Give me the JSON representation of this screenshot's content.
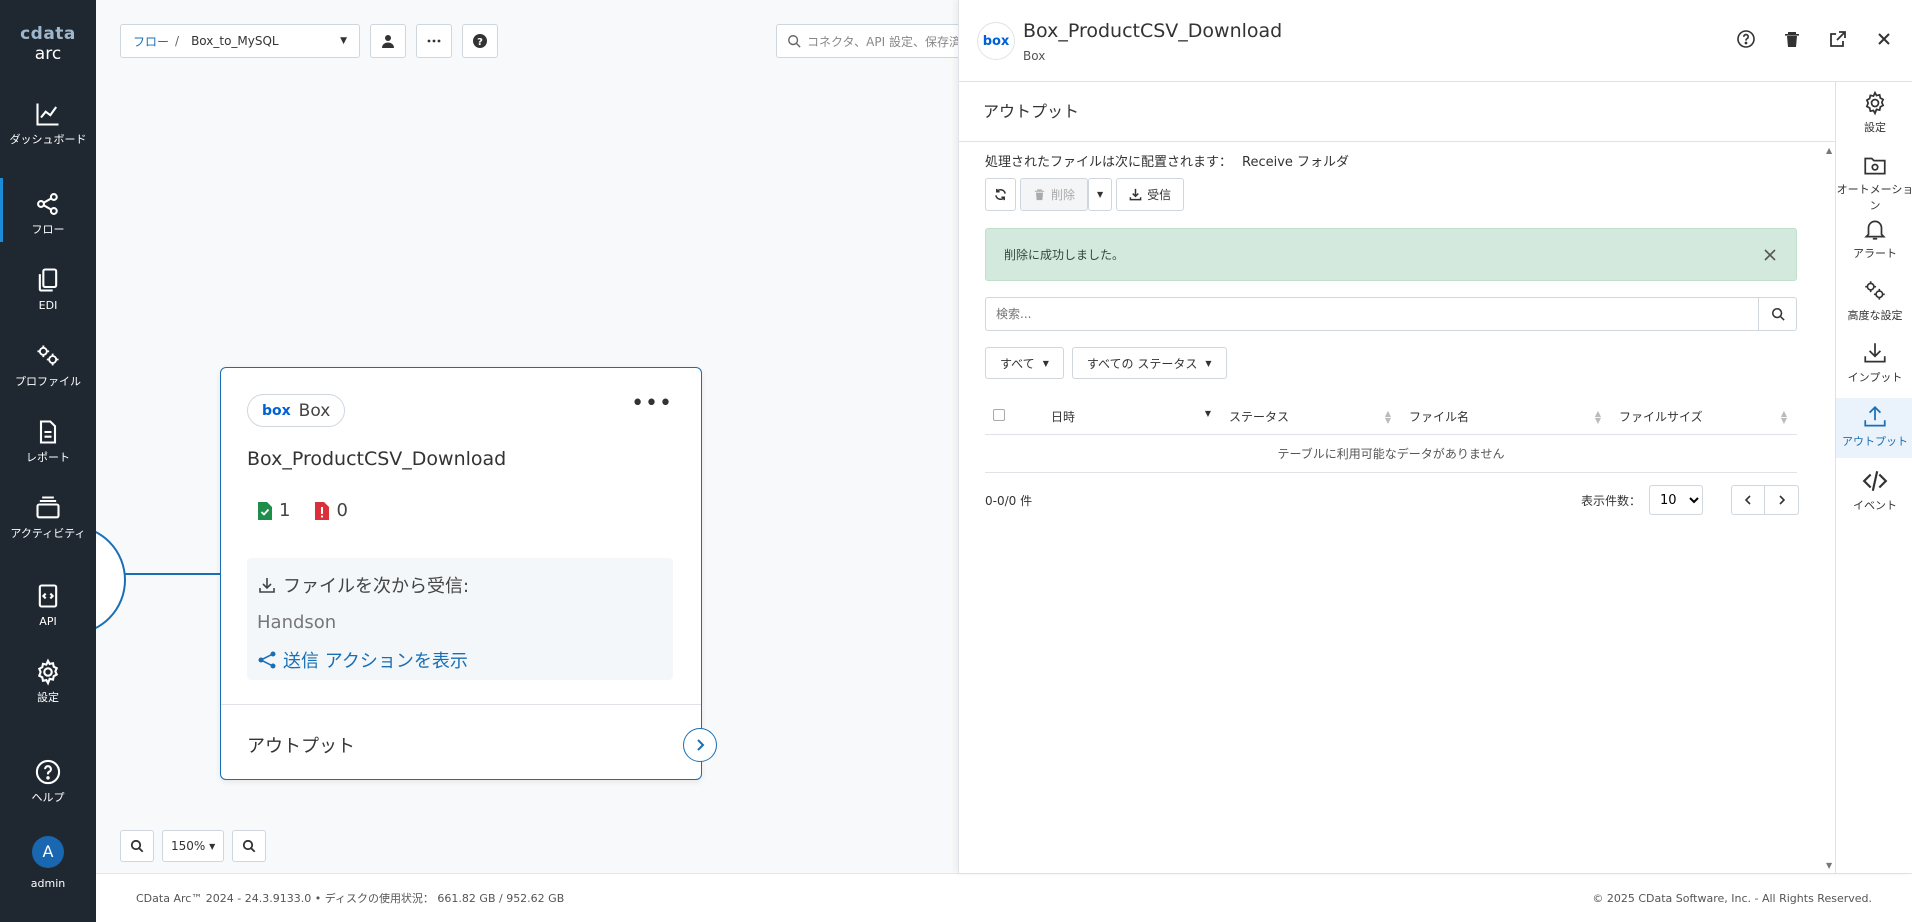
{
  "brand": {
    "line1": "cdata",
    "line2": "arc"
  },
  "nav": {
    "items": [
      {
        "label": "ダッシュボード"
      },
      {
        "label": "フロー"
      },
      {
        "label": "EDI"
      },
      {
        "label": "プロファイル"
      },
      {
        "label": "レポート"
      },
      {
        "label": "アクティビティ"
      },
      {
        "label": "API"
      },
      {
        "label": "設定"
      },
      {
        "label": "ヘルプ"
      }
    ],
    "user": {
      "initial": "A",
      "name": "admin"
    }
  },
  "breadcrumb": {
    "root": "フロー",
    "separator": "/",
    "current": "Box_to_MySQL"
  },
  "top_search": {
    "placeholder": "コネクタ、API 設定、保存済み"
  },
  "node": {
    "connector_label": "Box",
    "connector_logo": "box",
    "title": "Box_ProductCSV_Download",
    "success_count": "1",
    "error_count": "0",
    "receive_label": "ファイルを次から受信:",
    "receive_folder": "Handson",
    "send_action": "送信 アクションを表示",
    "output_label": "アウトプット"
  },
  "zoom": {
    "level": "150%"
  },
  "footer": {
    "version": "CData Arc™ 2024 - 24.3.9133.0 • ディスクの使用状況： 661.82 GB / 952.62 GB",
    "copyright": "© 2025 CData Software, Inc. - All Rights Reserved."
  },
  "panel": {
    "logo": "box",
    "title": "Box_ProductCSV_Download",
    "subtitle": "Box",
    "section_title": "アウトプット",
    "location_prefix": "処理されたファイルは次に配置されます：",
    "location_value": "Receive フォルダ",
    "buttons": {
      "delete": "削除",
      "receive": "受信"
    },
    "alert": "削除に成功しました。",
    "search": {
      "placeholder": "検索..."
    },
    "filters": {
      "scope": "すべて",
      "status": "すべての ステータス"
    },
    "table": {
      "headers": [
        "日時",
        "ステータス",
        "ファイル名",
        "ファイルサイズ"
      ],
      "empty": "テーブルに利用可能なデータがありません"
    },
    "count": "0-0/0 件",
    "page_size_label": "表示件数：",
    "page_size": "10"
  },
  "rail": {
    "items": [
      {
        "label": "設定"
      },
      {
        "label": "オートメーション"
      },
      {
        "label": "アラート"
      },
      {
        "label": "高度な設定"
      },
      {
        "label": "インプット"
      },
      {
        "label": "アウトプット"
      },
      {
        "label": "イベント"
      }
    ]
  },
  "colors": {
    "accent": "#1a6fb4",
    "nav_bg": "#1f2830",
    "success": "#1e8e4a",
    "error": "#d9303c",
    "alert_bg": "#d4e9dd"
  }
}
